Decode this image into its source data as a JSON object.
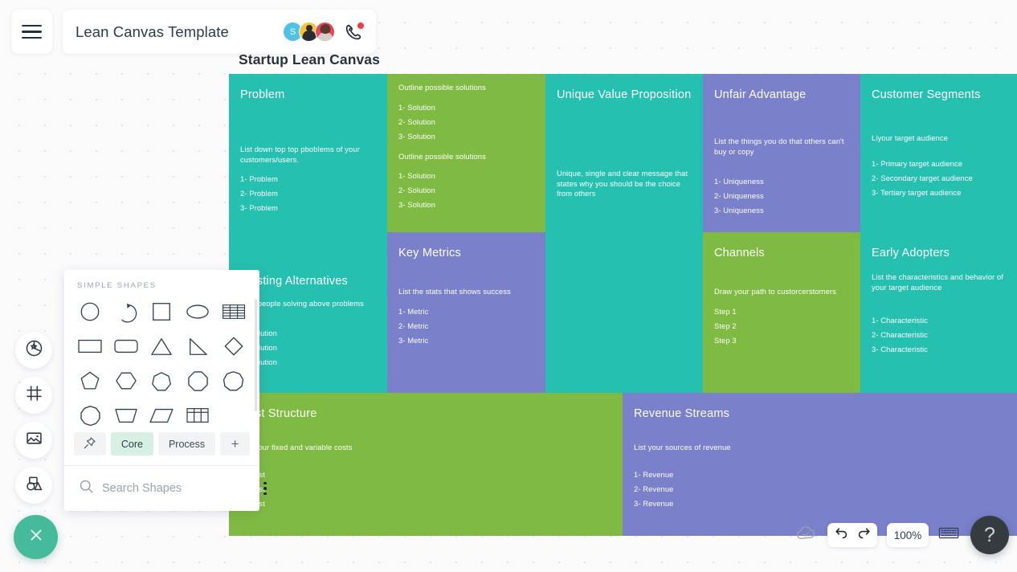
{
  "header": {
    "menu_icon": "hamburger-icon",
    "document_title": "Lean Canvas Template",
    "avatars": [
      {
        "initial": "S",
        "name": "collaborator-avatar-s"
      },
      {
        "initial": "",
        "name": "collaborator-avatar-2"
      },
      {
        "initial": "",
        "name": "collaborator-avatar-3"
      }
    ],
    "call_icon": "phone-icon",
    "call_badge": true
  },
  "canvas": {
    "title": "Startup Lean Canvas",
    "colors": {
      "teal": "#26c0b0",
      "green": "#7fbb42",
      "purple": "#7b80cb",
      "text": "#ffffff"
    },
    "cells": {
      "problem": {
        "heading": "Problem",
        "desc": "List down top top pboblems of your customers/users.",
        "items": [
          "1- Problem",
          "2- Problem",
          "3- Problem"
        ]
      },
      "alternatives": {
        "heading": "Existing Alternatives",
        "desc": "How people solving above problems now",
        "items": [
          "1- Solution",
          "2- Solution",
          "3- Solution"
        ]
      },
      "solution": {
        "heading": "Outline possible solutions",
        "items": [
          "1- Solution",
          "2- Solution",
          "3- Solution"
        ],
        "heading2": "Outline possible solutions",
        "items2": [
          "1- Solution",
          "2- Solution",
          "3- Solution"
        ]
      },
      "key_metrics": {
        "heading": "Key Metrics",
        "desc": "List the stats that shows success",
        "items": [
          "1- Metric",
          "2- Metric",
          "3- Metric"
        ]
      },
      "uvp": {
        "heading": "Unique Value Proposition",
        "desc": "Unique, single and clear message that states why you should be the choice from others",
        "items": []
      },
      "unfair_advantage": {
        "heading": "Unfair Advantage",
        "desc": "List the things you do that others can't buy or copy",
        "items": [
          "1- Uniqueness",
          "2- Uniqueness",
          "3- Uniqueness"
        ]
      },
      "channels": {
        "heading": "Channels",
        "desc": "Draw your path to custorcerstomers",
        "items": [
          "Step 1",
          "Step 2",
          "Step 3"
        ]
      },
      "customer_segments": {
        "heading": "Customer Segments",
        "desc": "Liyour target audience",
        "items": [
          "1- Primary target audience",
          "2- Secondary target audience",
          "3- Tertiary target audience"
        ]
      },
      "early_adopters": {
        "heading": "Early Adopters",
        "desc": "List the characteristics and behavior of your target audience",
        "items": [
          "1- Characteristic",
          "2- Characteristic",
          "3- Characteristic"
        ]
      },
      "cost_structure": {
        "heading": "Cost Structure",
        "desc": "List your fixed and variable costs",
        "items": [
          "1- Cost",
          "2- Cost",
          "3- Cost"
        ]
      },
      "revenue_streams": {
        "heading": "Revenue Streams",
        "desc": "List your sources of revenue",
        "items": [
          "1- Revenue",
          "2- Revenue",
          "3- Revenue"
        ]
      }
    }
  },
  "rail": {
    "items": [
      {
        "name": "shapes-style-icon"
      },
      {
        "name": "frame-icon"
      },
      {
        "name": "image-icon"
      },
      {
        "name": "shapes-library-icon"
      }
    ],
    "fab": {
      "name": "close-icon"
    }
  },
  "shapes_panel": {
    "section_label": "SIMPLE SHAPES",
    "shapes": [
      "circle",
      "arc",
      "square",
      "ellipse",
      "table-rows",
      "rectangle",
      "rounded-rectangle",
      "triangle",
      "right-triangle",
      "diamond",
      "pentagon",
      "hexagon",
      "heptagon",
      "octagon",
      "nonagon",
      "decagon",
      "trapezoid",
      "parallelogram",
      "table-grid"
    ],
    "tabs": [
      {
        "label": "",
        "name": "pin-tab",
        "icon": "pin-icon",
        "active": false
      },
      {
        "label": "Core",
        "name": "core-tab",
        "active": true
      },
      {
        "label": "Process",
        "name": "process-tab",
        "active": false
      },
      {
        "label": "+",
        "name": "add-tab",
        "active": false
      }
    ],
    "search_placeholder": "Search Shapes",
    "search_value": "",
    "more_icon": "kebab-menu-icon"
  },
  "bottombar": {
    "save_icon": "cloud-saved-icon",
    "undo_icon": "undo-icon",
    "redo_icon": "redo-icon",
    "zoom_level": "100%",
    "keyboard_icon": "keyboard-icon",
    "help_label": "?"
  }
}
